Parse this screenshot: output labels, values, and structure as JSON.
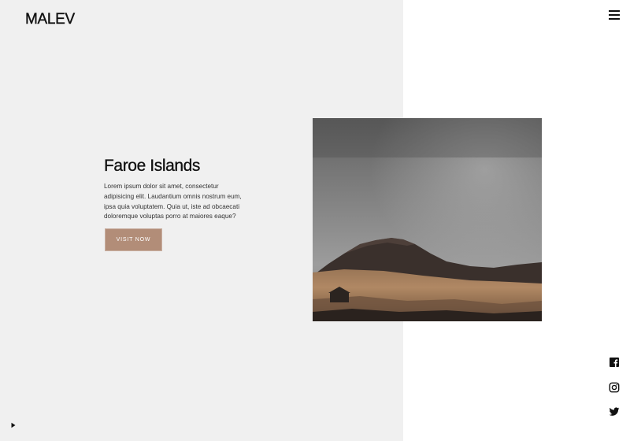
{
  "brand": {
    "logo_text": "MALEV"
  },
  "header": {
    "menu_icon": "hamburger-menu-icon"
  },
  "hero": {
    "title": "Faroe Islands",
    "description": "Lorem ipsum dolor sit amet, consectetur adipisicing elit. Laudantium omnis nostrum eum, ipsa quia voluptatem. Quia ut, iste ad obcaecati doloremque voluptas porro at maiores eaque?",
    "cta_label": "VISIT NOW",
    "image_alt": "Foggy mountain landscape"
  },
  "social": [
    {
      "name": "facebook",
      "icon": "facebook-icon"
    },
    {
      "name": "instagram",
      "icon": "instagram-icon"
    },
    {
      "name": "twitter",
      "icon": "twitter-icon"
    }
  ],
  "player": {
    "icon": "play-icon"
  },
  "colors": {
    "left_panel_bg": "#f0f0f0",
    "right_bg": "#ffffff",
    "cta_bg": "#b28d78",
    "text_dark": "#111111"
  }
}
